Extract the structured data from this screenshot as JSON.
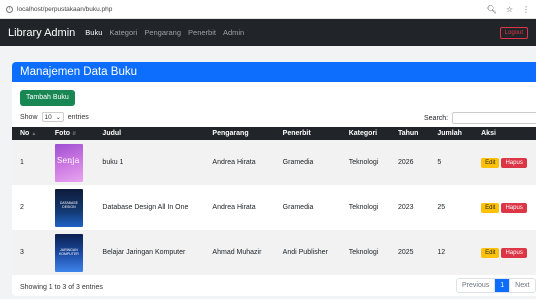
{
  "browser": {
    "url": "localhost/perpustakaan/buku.php"
  },
  "navbar": {
    "brand": "Library Admin",
    "items": [
      {
        "label": "Buku",
        "active": true
      },
      {
        "label": "Kategori",
        "active": false
      },
      {
        "label": "Pengarang",
        "active": false
      },
      {
        "label": "Penerbit",
        "active": false
      },
      {
        "label": "Admin",
        "active": false
      }
    ],
    "logout": "Logout"
  },
  "card": {
    "title": "Manajemen Data Buku",
    "add_button": "Tambah Buku",
    "show_label": "Show",
    "entries_value": "10",
    "entries_label": "entries",
    "search_label": "Search:"
  },
  "table": {
    "headers": [
      "No",
      "Foto",
      "Judul",
      "Pengarang",
      "Penerbit",
      "Kategori",
      "Tahun",
      "Jumlah",
      "Aksi"
    ],
    "rows": [
      {
        "no": "1",
        "cover_text": "Senja",
        "judul": "buku 1",
        "pengarang": "Andrea Hirata",
        "penerbit": "Gramedia",
        "kategori": "Teknologi",
        "tahun": "2026",
        "jumlah": "5"
      },
      {
        "no": "2",
        "cover_text": "DATABASE DESIGN",
        "judul": "Database Design All In One",
        "pengarang": "Andrea Hirata",
        "penerbit": "Gramedia",
        "kategori": "Teknologi",
        "tahun": "2023",
        "jumlah": "25"
      },
      {
        "no": "3",
        "cover_text": "JARINGAN KOMPUTER",
        "judul": "Belajar Jaringan Komputer",
        "pengarang": "Ahmad Muhazir",
        "penerbit": "Andi Publisher",
        "kategori": "Teknologi",
        "tahun": "2025",
        "jumlah": "12"
      }
    ],
    "edit_label": "Edit",
    "delete_label": "Hapus"
  },
  "footer": {
    "info": "Showing 1 to 3 of 3 entries",
    "previous": "Previous",
    "page": "1",
    "next": "Next"
  },
  "colors": {
    "primary": "#0d6efd",
    "success": "#198754",
    "warning": "#ffc107",
    "danger": "#dc3545",
    "dark": "#212529"
  }
}
